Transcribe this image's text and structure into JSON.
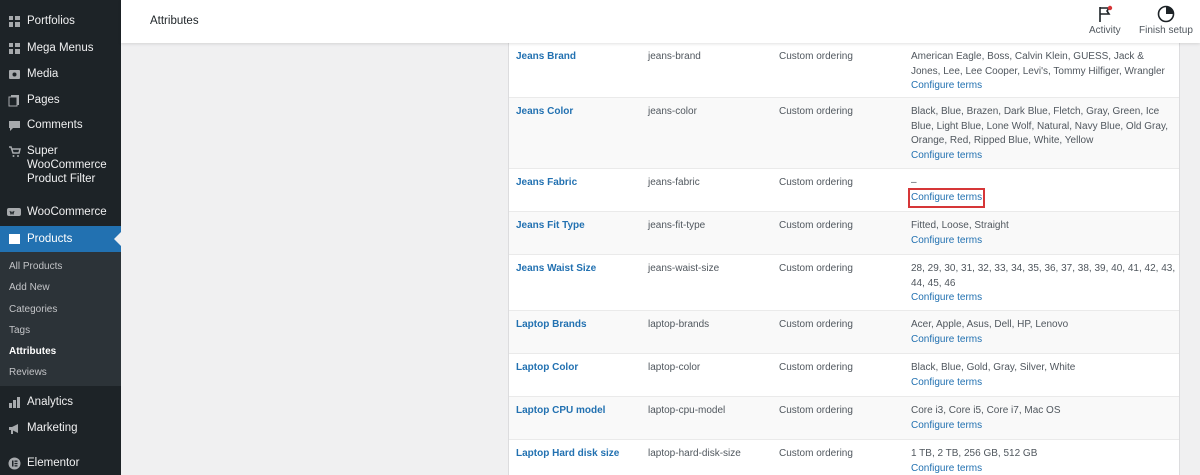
{
  "sidebar": {
    "items": [
      {
        "label": "Portfolios",
        "icon": "portfolio-icon"
      },
      {
        "label": "Mega Menus",
        "icon": "mega-menu-icon"
      },
      {
        "label": "Media",
        "icon": "media-icon"
      },
      {
        "label": "Pages",
        "icon": "pages-icon"
      },
      {
        "label": "Comments",
        "icon": "comments-icon"
      },
      {
        "label": "Super WooCommerce Product Filter",
        "icon": "cart-icon"
      },
      {
        "label": "WooCommerce",
        "icon": "woocommerce-icon"
      },
      {
        "label": "Products",
        "icon": "products-icon"
      }
    ],
    "submenu": [
      "All Products",
      "Add New",
      "Categories",
      "Tags",
      "Attributes",
      "Reviews"
    ],
    "bottom": [
      {
        "label": "Analytics",
        "icon": "analytics-icon"
      },
      {
        "label": "Marketing",
        "icon": "marketing-icon"
      },
      {
        "label": "Elementor",
        "icon": "elementor-icon"
      }
    ]
  },
  "header": {
    "title": "Attributes",
    "activity": "Activity",
    "finish_setup": "Finish setup"
  },
  "table": {
    "configure_label": "Configure terms",
    "rows": [
      {
        "name": "Jeans Brand",
        "slug": "jeans-brand",
        "order": "Custom ordering",
        "terms": "American Eagle, Boss, Calvin Klein, GUESS, Jack & Jones, Lee, Lee Cooper, Levi's, Tommy Hilfiger, Wrangler"
      },
      {
        "name": "Jeans Color",
        "slug": "jeans-color",
        "order": "Custom ordering",
        "terms": "Black, Blue, Brazen, Dark Blue, Fletch, Gray, Green, Ice Blue, Light Blue, Lone Wolf, Natural, Navy Blue, Old Gray, Orange, Red, Ripped Blue, White, Yellow"
      },
      {
        "name": "Jeans Fabric",
        "slug": "jeans-fabric",
        "order": "Custom ordering",
        "terms": "–"
      },
      {
        "name": "Jeans Fit Type",
        "slug": "jeans-fit-type",
        "order": "Custom ordering",
        "terms": "Fitted, Loose, Straight"
      },
      {
        "name": "Jeans Waist Size",
        "slug": "jeans-waist-size",
        "order": "Custom ordering",
        "terms": "28, 29, 30, 31, 32, 33, 34, 35, 36, 37, 38, 39, 40, 41, 42, 43, 44, 45, 46"
      },
      {
        "name": "Laptop Brands",
        "slug": "laptop-brands",
        "order": "Custom ordering",
        "terms": "Acer, Apple, Asus, Dell, HP, Lenovo"
      },
      {
        "name": "Laptop Color",
        "slug": "laptop-color",
        "order": "Custom ordering",
        "terms": "Black, Blue, Gold, Gray, Silver, White"
      },
      {
        "name": "Laptop CPU model",
        "slug": "laptop-cpu-model",
        "order": "Custom ordering",
        "terms": "Core i3, Core i5, Core i7, Mac OS"
      },
      {
        "name": "Laptop Hard disk size",
        "slug": "laptop-hard-disk-size",
        "order": "Custom ordering",
        "terms": "1 TB, 2 TB, 256 GB, 512 GB"
      }
    ]
  },
  "colors": {
    "accent": "#2271b1",
    "sidebar": "#1d2327",
    "highlight": "#d63638"
  }
}
